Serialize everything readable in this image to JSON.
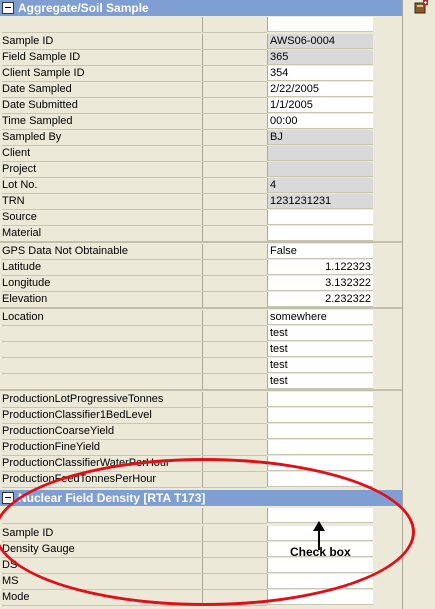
{
  "section1": {
    "title": "Aggregate/Soil Sample"
  },
  "section2": {
    "title": "Nuclear Field Density [RTA T173]"
  },
  "rows1": [
    {
      "label": "Sample ID",
      "value": "AWS06-0004",
      "ro": true
    },
    {
      "label": "Field Sample ID",
      "value": "365",
      "ro": true
    },
    {
      "label": "Client Sample ID",
      "value": "354",
      "ro": false
    },
    {
      "label": "Date Sampled",
      "value": "2/22/2005",
      "ro": false
    },
    {
      "label": "Date Submitted",
      "value": "1/1/2005",
      "ro": false
    },
    {
      "label": "Time Sampled",
      "value": "00:00",
      "ro": false
    },
    {
      "label": "Sampled By",
      "value": "BJ",
      "ro": true
    },
    {
      "label": "Client",
      "value": "",
      "ro": true
    },
    {
      "label": "Project",
      "value": "",
      "ro": true
    },
    {
      "label": "Lot No.",
      "value": "4",
      "ro": true
    },
    {
      "label": "TRN",
      "value": "1231231231",
      "ro": true
    },
    {
      "label": "Source",
      "value": "",
      "ro": false
    },
    {
      "label": "Material",
      "value": "",
      "ro": false
    }
  ],
  "rows2": [
    {
      "label": "GPS Data Not Obtainable",
      "value": "False",
      "num": false
    },
    {
      "label": "Latitude",
      "value": "1.122323",
      "num": true
    },
    {
      "label": "Longitude",
      "value": "3.132322",
      "num": true
    },
    {
      "label": "Elevation",
      "value": "2.232322",
      "num": true
    }
  ],
  "rows3": [
    {
      "label": "Location",
      "value": "somewhere"
    },
    {
      "label": "",
      "value": "test"
    },
    {
      "label": "",
      "value": "test"
    },
    {
      "label": "",
      "value": "test"
    },
    {
      "label": "",
      "value": "test"
    }
  ],
  "rows4": [
    {
      "label": "ProductionLotProgressiveTonnes"
    },
    {
      "label": "ProductionClassifier1BedLevel"
    },
    {
      "label": "ProductionCoarseYield"
    },
    {
      "label": "ProductionFineYield"
    },
    {
      "label": "ProductionClassifierWaterPerHour"
    },
    {
      "label": "ProductionFeedTonnesPerHour"
    }
  ],
  "rows5": [
    {
      "label": "Sample ID"
    },
    {
      "label": "Density Gauge"
    },
    {
      "label": "DS"
    },
    {
      "label": "MS"
    },
    {
      "label": "Mode"
    }
  ],
  "annotation": {
    "text": "Check box",
    "color": "#e0101a"
  },
  "colors": {
    "header": "#7f9fd3",
    "background": "#ece9d8",
    "readonly": "#d9d9d9"
  },
  "icons": {
    "top_right": "add-record-icon",
    "checkbox_checked": "checkmark-icon"
  }
}
